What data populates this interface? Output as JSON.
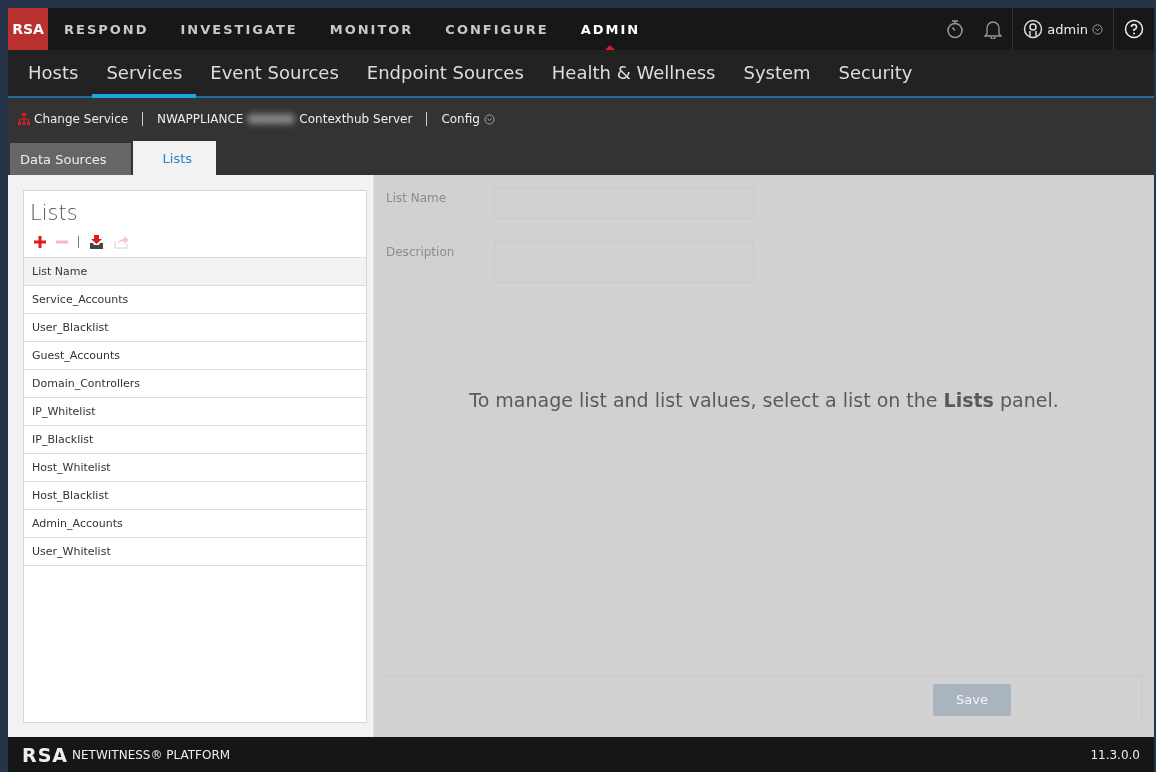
{
  "logo": "RSA",
  "main_nav": [
    {
      "label": "RESPOND",
      "selected": false
    },
    {
      "label": "INVESTIGATE",
      "selected": false
    },
    {
      "label": "MONITOR",
      "selected": false
    },
    {
      "label": "CONFIGURE",
      "selected": false
    },
    {
      "label": "ADMIN",
      "selected": true
    }
  ],
  "user": {
    "name": "admin"
  },
  "sub_nav": [
    {
      "label": "Hosts",
      "selected": false
    },
    {
      "label": "Services",
      "selected": true
    },
    {
      "label": "Event Sources",
      "selected": false
    },
    {
      "label": "Endpoint Sources",
      "selected": false
    },
    {
      "label": "Health & Wellness",
      "selected": false
    },
    {
      "label": "System",
      "selected": false
    },
    {
      "label": "Security",
      "selected": false
    }
  ],
  "service_bar": {
    "change_service": "Change Service",
    "appliance": "NWAPPLIANCE",
    "service": "Contexthub Server",
    "config": "Config"
  },
  "tabs": [
    {
      "label": "Data Sources",
      "selected": false
    },
    {
      "label": "Lists",
      "selected": true
    }
  ],
  "lists_panel": {
    "title": "Lists",
    "toolbar": [
      {
        "kind": "add",
        "disabled": false
      },
      {
        "kind": "remove",
        "disabled": true
      },
      {
        "kind": "separator"
      },
      {
        "kind": "import",
        "disabled": false
      },
      {
        "kind": "export",
        "disabled": true
      }
    ],
    "column": "List Name",
    "rows": [
      "Service_Accounts",
      "User_Blacklist",
      "Guest_Accounts",
      "Domain_Controllers",
      "IP_Whitelist",
      "IP_Blacklist",
      "Host_Whitelist",
      "Host_Blacklist",
      "Admin_Accounts",
      "User_Whitelist"
    ]
  },
  "detail": {
    "disabled": true,
    "fields": [
      {
        "label": "List Name",
        "kind": "line"
      },
      {
        "label": "Description",
        "kind": "area"
      }
    ],
    "message": "To manage list and list values, select a list on the **Lists** panel.",
    "save": {
      "label": "Save",
      "disabled": true
    }
  },
  "footer": {
    "brand": "RSA",
    "product": "NETWITNESS® PLATFORM",
    "version": "11.3.0.0"
  }
}
